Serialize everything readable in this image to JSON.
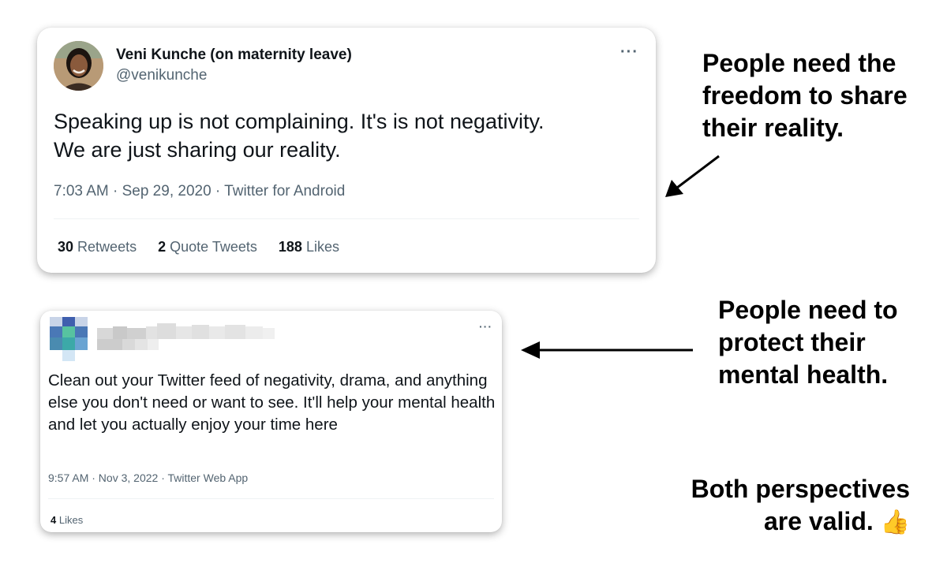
{
  "tweet1": {
    "author_name": "Veni Kunche (on maternity leave)",
    "author_handle": "@venikunche",
    "more_icon": "···",
    "text_line1": "Speaking up is not complaining. It's is not negativity.",
    "text_line2": "We are just sharing our reality.",
    "meta": "7:03 AM · Sep 29, 2020 · Twitter for Android",
    "stats": {
      "retweets_count": "30",
      "retweets_label": "Retweets",
      "quotes_count": "2",
      "quotes_label": "Quote Tweets",
      "likes_count": "188",
      "likes_label": "Likes"
    }
  },
  "tweet2": {
    "more_icon": "···",
    "text": "Clean out your Twitter feed of negativity, drama, and anything else you don't need or want to see. It'll help your mental health and let you actually enjoy your time here",
    "meta": "9:57 AM · Nov 3, 2022 · Twitter Web App",
    "stats": {
      "likes_count": "4",
      "likes_label": "Likes"
    }
  },
  "annotations": {
    "note1_line1": "People need the",
    "note1_line2": "freedom to share",
    "note1_line3": "their reality.",
    "note2_line1": "People need to",
    "note2_line2": "protect their",
    "note2_line3": "mental health.",
    "note3_line1": "Both perspectives",
    "note3_line2": "are valid.",
    "note3_emoji": "👍"
  },
  "icons": {
    "avatar_1": "avatar-photo",
    "avatar_2": "avatar-blurred",
    "more_1": "more-options-icon",
    "more_2": "more-options-icon",
    "thumbs_up": "thumbs-up-emoji",
    "arrow_1": "arrow-down-left",
    "arrow_2": "arrow-left"
  },
  "colors": {
    "text_primary": "#0f1419",
    "text_secondary": "#536471",
    "divider": "#eff3f4",
    "annotation": "#000000"
  }
}
